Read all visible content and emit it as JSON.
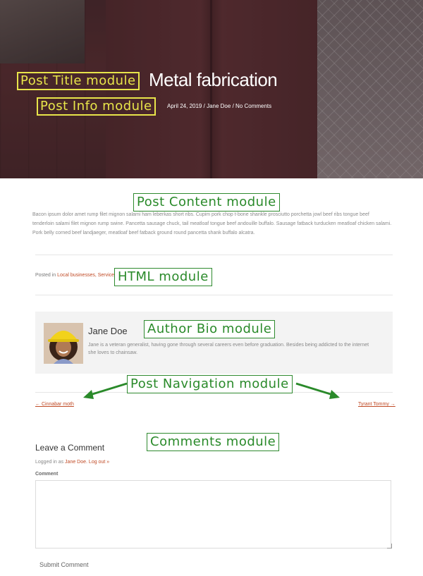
{
  "post": {
    "title": "Metal fabrication",
    "date": "April 24, 2019",
    "sep1": "/",
    "author": "Jane Doe",
    "sep2": "/",
    "comments_link": "No Comments",
    "content": "Bacon ipsum dolor amet rump filet mignon salami ham leberkas short ribs. Cupim pork chop t-bone shankle prosciutto porchetta jowl beef ribs tongue beef tenderloin salami filet mignon rump swine. Pancetta sausage chuck, tail meatloaf tongue beef andouille buffalo. Sausage fatback turducken meatloaf chicken salami. Pork belly corned beef landjaeger, meatloaf beef fatback ground round pancetta shank buffalo alcatra.",
    "posted_in_label": "Posted in",
    "categories": "Local businesses, Services"
  },
  "author_bio": {
    "name": "Jane Doe",
    "text": "Jane is a veteran generalist, having gone through several careers even before graduation. Besides being addicted to the internet she loves to chainsaw."
  },
  "post_nav": {
    "prev": "← Cinnabar moth",
    "next": "Tyrant Tommy →"
  },
  "comments": {
    "heading": "Leave a Comment",
    "logged_in_prefix": "Logged in as",
    "logged_in_user": "Jane Doe.",
    "logout": "Log out »",
    "comment_label": "Comment",
    "submit": "Submit Comment"
  },
  "annotations": {
    "post_title": "Post Title module",
    "post_info": "Post Info module",
    "post_content": "Post Content module",
    "html": "HTML module",
    "author_bio": "Author Bio module",
    "post_navigation": "Post Navigation module",
    "comments": "Comments module"
  },
  "colors": {
    "link": "#c04a25",
    "annotation_yellow": "#e8e54a",
    "annotation_green": "#2a8a2a"
  }
}
